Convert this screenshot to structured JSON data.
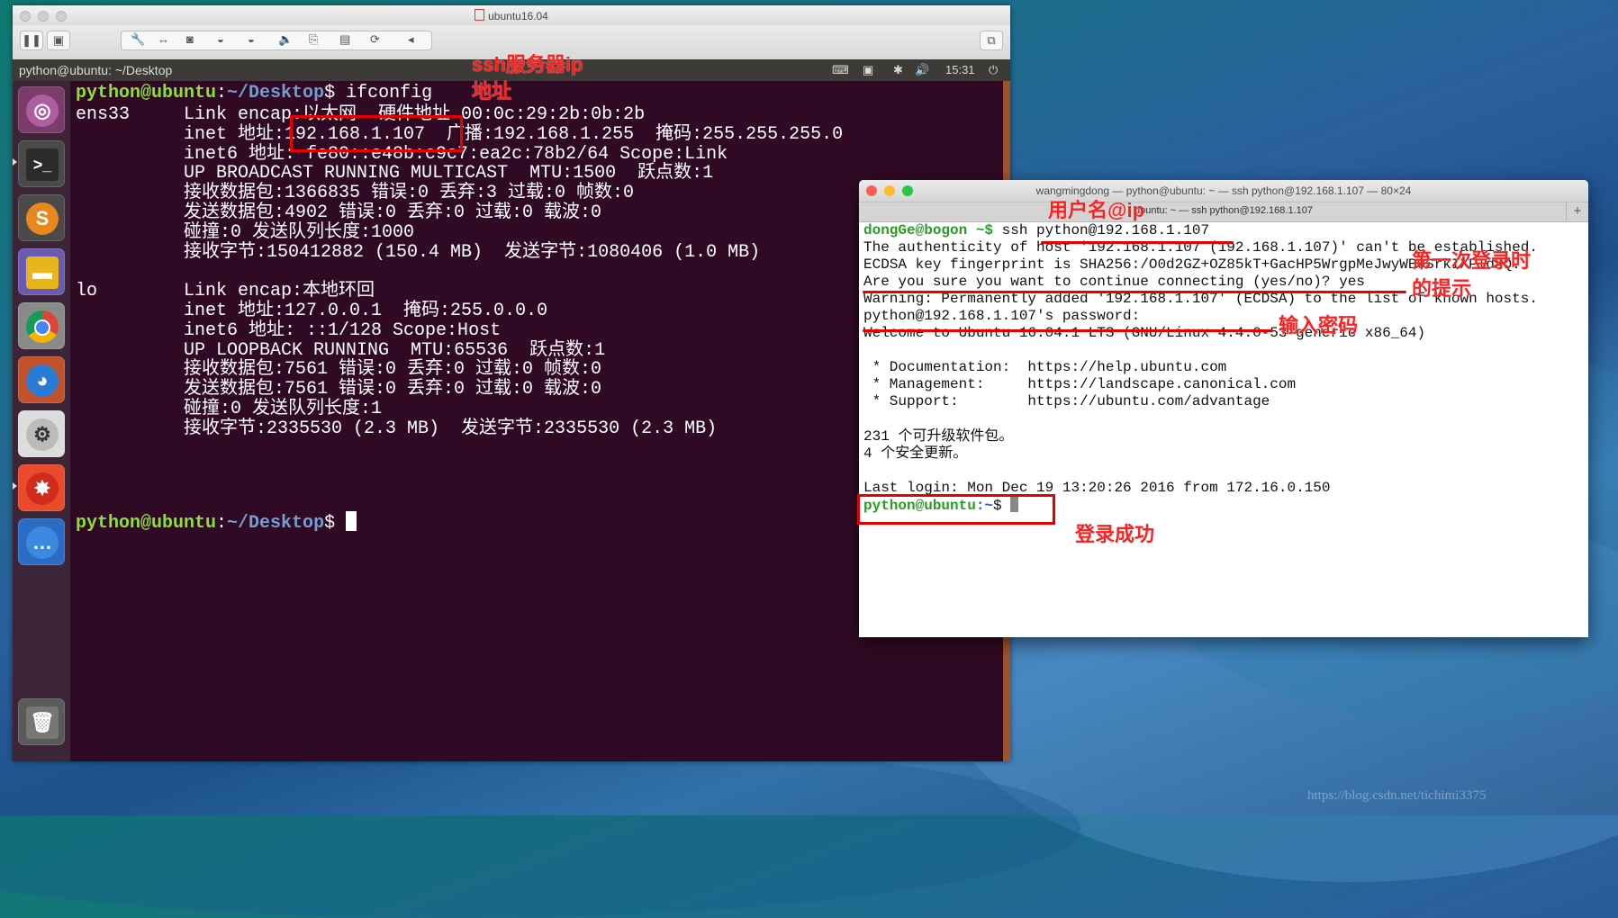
{
  "vm": {
    "title": "ubuntu16.04",
    "panel_title": "python@ubuntu: ~/Desktop",
    "panel_time": "15:31",
    "icons": [
      "pause-icon",
      "snapshot-icon",
      "wrench-icon",
      "network-icon",
      "disk-icon",
      "cdrom-icon",
      "cdrom-icon",
      "volume-icon",
      "usb-icon",
      "save-icon",
      "share-icon",
      "chevron-left-icon"
    ]
  },
  "launcher": [
    "ubuntu-dash-icon",
    "terminal-icon",
    "sublime-icon",
    "files-icon",
    "chrome-icon",
    "firefox-icon",
    "settings-toggle-icon",
    "crash-report-icon",
    "more-apps-icon",
    "trash-icon"
  ],
  "ubuntu_terminal": {
    "prompt_user": "python@ubuntu",
    "prompt_path": "~/Desktop",
    "prompt_sym": "$ ",
    "command": "ifconfig",
    "lines": [
      "ens33     Link encap:以太网  硬件地址 00:0c:29:2b:0b:2b",
      "          inet 地址:192.168.1.107  广播:192.168.1.255  掩码:255.255.255.0",
      "          inet6 地址: fe80::e48b:c9c7:ea2c:78b2/64 Scope:Link",
      "          UP BROADCAST RUNNING MULTICAST  MTU:1500  跃点数:1",
      "          接收数据包:1366835 错误:0 丢弃:3 过载:0 帧数:0",
      "          发送数据包:4902 错误:0 丢弃:0 过载:0 载波:0",
      "          碰撞:0 发送队列长度:1000",
      "          接收字节:150412882 (150.4 MB)  发送字节:1080406 (1.0 MB)",
      "",
      "lo        Link encap:本地环回",
      "          inet 地址:127.0.0.1  掩码:255.0.0.0",
      "          inet6 地址: ::1/128 Scope:Host",
      "          UP LOOPBACK RUNNING  MTU:65536  跃点数:1",
      "          接收数据包:7561 错误:0 丢弃:0 过载:0 帧数:0",
      "          发送数据包:7561 错误:0 丢弃:0 过载:0 载波:0",
      "          碰撞:0 发送队列长度:1",
      "          接收字节:2335530 (2.3 MB)  发送字节:2335530 (2.3 MB)"
    ]
  },
  "mac_terminal": {
    "title": "wangmingdong — python@ubuntu: ~ — ssh python@192.168.1.107 — 80×24",
    "tab_title": "ubuntu: ~ — ssh python@192.168.1.107",
    "local_prompt": "dongGe@bogon ~$ ",
    "ssh_command": "ssh python@192.168.1.107",
    "lines": [
      "The authenticity of host '192.168.1.107 (192.168.1.107)' can't be established.",
      "ECDSA key fingerprint is SHA256:/O0d2GZ+OZ85kT+GacHP5WrgpMeJwyWBOSrkIXPIdXQ.",
      "Are you sure you want to continue connecting (yes/no)? yes",
      "Warning: Permanently added '192.168.1.107' (ECDSA) to the list of known hosts.",
      "python@192.168.1.107's password:",
      "Welcome to Ubuntu 16.04.1 LTS (GNU/Linux 4.4.0-53-generic x86_64)",
      "",
      " * Documentation:  https://help.ubuntu.com",
      " * Management:     https://landscape.canonical.com",
      " * Support:        https://ubuntu.com/advantage",
      "",
      "231 个可升级软件包。",
      "4 个安全更新。",
      "",
      "Last login: Mon Dec 19 13:20:26 2016 from 172.16.0.150"
    ],
    "remote_prompt_user": "python@ubuntu",
    "remote_prompt_path": ":~",
    "remote_prompt_sym": "$ "
  },
  "annotations": {
    "ssh_ip_line1": "ssh服务器ip",
    "ssh_ip_line2": "地址",
    "user_at_ip": "用户名@ip",
    "first_login_line1": "第一次登录时",
    "first_login_line2": "的提示",
    "enter_password": "输入密码",
    "login_success": "登录成功"
  },
  "watermark": "https://blog.csdn.net/tichimi3375"
}
